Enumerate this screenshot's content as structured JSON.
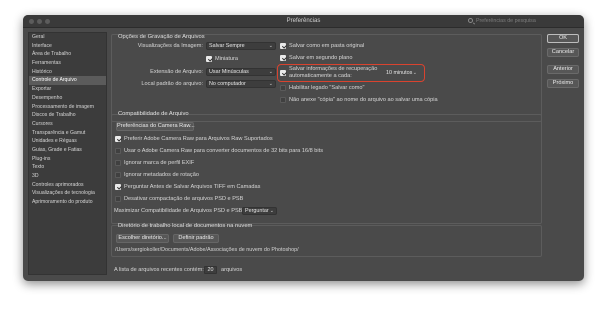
{
  "window": {
    "title": "Preferências",
    "search_placeholder": "Preferências de pesquisa"
  },
  "sidebar": {
    "items": [
      {
        "label": "Geral"
      },
      {
        "label": "Interface"
      },
      {
        "label": "Área de Trabalho"
      },
      {
        "label": "Ferramentas"
      },
      {
        "label": "Histórico"
      },
      {
        "label": "Controle de Arquivo"
      },
      {
        "label": "Exportar"
      },
      {
        "label": "Desempenho"
      },
      {
        "label": "Processamento de imagem"
      },
      {
        "label": "Discos de Trabalho"
      },
      {
        "label": "Cursores"
      },
      {
        "label": "Transparência e Gamut"
      },
      {
        "label": "Unidades e Réguas"
      },
      {
        "label": "Guias, Grade e Fatias"
      },
      {
        "label": "Plug-ins"
      },
      {
        "label": "Texto"
      },
      {
        "label": "3D"
      },
      {
        "label": "Controles aprimorados"
      },
      {
        "label": "Visualizações de tecnologia"
      },
      {
        "label": "Aprimoramento do produto"
      }
    ],
    "selected": "Controle de Arquivo"
  },
  "save_options": {
    "title": "Opções de Gravação de Arquivos",
    "image_preview_label": "Visualizações da Imagem:",
    "image_preview_value": "Salvar Sempre",
    "thumbnail_label": "Miniatura",
    "thumbnail_checked": true,
    "extension_label": "Extensão de Arquivo:",
    "extension_value": "Usar Minúsculas",
    "default_location_label": "Local padrão do arquivo:",
    "default_location_value": "No computador",
    "save_as_original_label": "Salvar como em pasta original",
    "save_as_original_checked": true,
    "save_background_label": "Salvar em segundo plano",
    "save_background_checked": true,
    "autosave_label_line1": "Salvar informações de recuperação",
    "autosave_label_line2": "automaticamente a cada:",
    "autosave_checked": true,
    "autosave_interval": "10 minutos",
    "legacy_save_as_label": "Habilitar legado \"Salvar como\"",
    "legacy_save_as_checked": false,
    "no_copy_label": "Não anexe \"cópia\" ao nome do arquivo ao salvar uma cópia",
    "no_copy_checked": false
  },
  "compat": {
    "title": "Compatibilidade de Arquivo",
    "camera_raw_button": "Preferências do Camera Raw...",
    "options": [
      {
        "label": "Preferir Adobe Camera Raw para Arquivos Raw Suportados",
        "checked": true
      },
      {
        "label": "Usar o Adobe Camera Raw para converter documentos de 32 bits para 16/8 bits",
        "checked": false
      },
      {
        "label": "Ignorar marca de perfil EXIF",
        "checked": false
      },
      {
        "label": "Ignorar metadados de rotação",
        "checked": false
      },
      {
        "label": "Perguntar Antes de Salvar Arquivos TIFF em Camadas",
        "checked": true
      },
      {
        "label": "Desativar compactação de arquivos PSD e PSB",
        "checked": false
      }
    ],
    "max_compat_label": "Maximizar Compatibilidade de Arquivos PSD e PSB:",
    "max_compat_value": "Perguntar"
  },
  "cloud_dir": {
    "title": "Diretório de trabalho local de documentos na nuvem",
    "choose_button": "Escolher diretório...",
    "default_button": "Definir padrão",
    "path": "/Users/sergiokoller/Documents/Adobe/Associações de nuvem do Photoshop/"
  },
  "recent": {
    "label_before": "A lista de arquivos recentes contém:",
    "value": "20",
    "label_after": "arquivos"
  },
  "buttons": {
    "ok": "OK",
    "cancel": "Cancelar",
    "previous": "Anterior",
    "next": "Próximo"
  },
  "colors": {
    "window_bg": "#4a4a4a",
    "sidebar_bg": "#3c3c3c",
    "highlight": "#d9432f"
  }
}
